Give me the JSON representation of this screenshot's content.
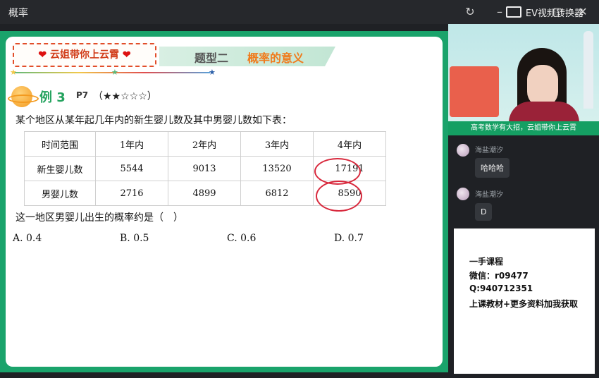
{
  "window": {
    "title": "概率"
  },
  "toolbar": {
    "converter_label": "EV视频转换器"
  },
  "slide": {
    "banner_left": "云姐带你上云霄",
    "banner_topic": "题型二",
    "banner_title": "概率的意义",
    "example_label": "例 3",
    "example_page": "P7",
    "example_rating": "（★★☆☆☆）",
    "question": "某个地区从某年起几年内的新生婴儿数及其中男婴儿数如下表：",
    "table": {
      "headers": [
        "时间范围",
        "1年内",
        "2年内",
        "3年内",
        "4年内"
      ],
      "rows": [
        [
          "新生婴儿数",
          "5544",
          "9013",
          "13520",
          "17191"
        ],
        [
          "男婴儿数",
          "2716",
          "4899",
          "6812",
          "8590"
        ]
      ]
    },
    "ask": "这一地区男婴儿出生的概率约是（　）",
    "options": [
      "A. 0.4",
      "B. 0.5",
      "C. 0.6",
      "D. 0.7"
    ]
  },
  "video": {
    "caption": "高考数学有大招，云姐带你上云霄"
  },
  "chat": {
    "messages": [
      {
        "name": "海盐潮汐",
        "text": "哈哈哈"
      },
      {
        "name": "海盐潮汐",
        "text": "D"
      }
    ]
  },
  "promo": {
    "line1": "一手课程",
    "line2": "微信：r09477",
    "line3": "Q:940712351",
    "line4": "上课教材+更多资料加我获取"
  },
  "colors": {
    "slide_frame": "#1aa36b",
    "accent_orange": "#f07a1a",
    "ink_red": "#d8283c"
  }
}
